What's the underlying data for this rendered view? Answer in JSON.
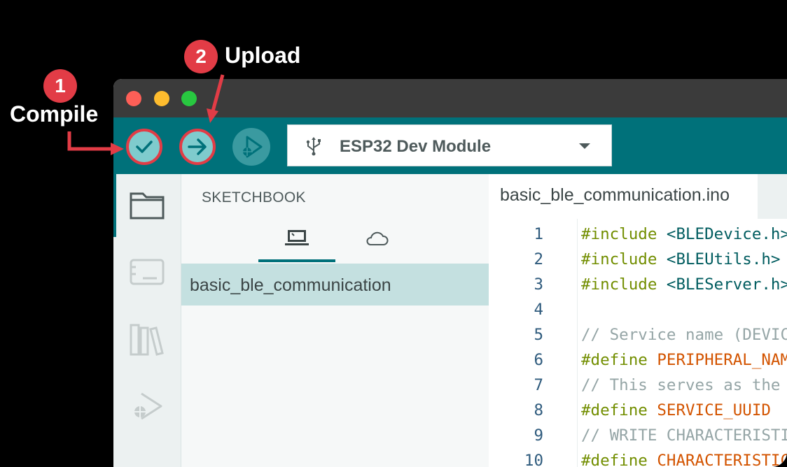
{
  "annotations": {
    "compile": {
      "number": "1",
      "label": "Compile"
    },
    "upload": {
      "number": "2",
      "label": "Upload"
    }
  },
  "window": {
    "traffic_lights": [
      "close",
      "minimize",
      "maximize"
    ]
  },
  "toolbar": {
    "verify_icon": "checkmark-icon",
    "upload_icon": "arrow-right-icon",
    "debug_icon": "debug-icon",
    "board_name": "ESP32 Dev Module",
    "board_icon": "usb-icon"
  },
  "sidebar": {
    "items": [
      "sketchbook-icon",
      "boards-manager-icon",
      "library-manager-icon",
      "debug-icon"
    ]
  },
  "sketchbook": {
    "title": "SKETCHBOOK",
    "tabs": [
      "local-icon",
      "cloud-icon"
    ],
    "items": [
      "basic_ble_communication"
    ]
  },
  "editor": {
    "tab_name": "basic_ble_communication.ino",
    "lines": [
      {
        "num": "1",
        "parts": [
          {
            "t": "#include ",
            "c": "kw"
          },
          {
            "t": "<BLEDevice.h>",
            "c": "inc"
          }
        ]
      },
      {
        "num": "2",
        "parts": [
          {
            "t": "#include ",
            "c": "kw"
          },
          {
            "t": "<BLEUtils.h>",
            "c": "inc"
          }
        ]
      },
      {
        "num": "3",
        "parts": [
          {
            "t": "#include ",
            "c": "kw"
          },
          {
            "t": "<BLEServer.h>",
            "c": "inc"
          }
        ]
      },
      {
        "num": "4",
        "parts": []
      },
      {
        "num": "5",
        "parts": [
          {
            "t": "// Service name (DEVICE",
            "c": "cm"
          }
        ]
      },
      {
        "num": "6",
        "parts": [
          {
            "t": "#define ",
            "c": "kw"
          },
          {
            "t": "PERIPHERAL_NAME",
            "c": "mac"
          }
        ]
      },
      {
        "num": "7",
        "parts": [
          {
            "t": "// This serves as the",
            "c": "cm"
          }
        ]
      },
      {
        "num": "8",
        "parts": [
          {
            "t": "#define ",
            "c": "kw"
          },
          {
            "t": "SERVICE_UUID",
            "c": "mac"
          }
        ]
      },
      {
        "num": "9",
        "parts": [
          {
            "t": "// WRITE CHARACTERISTIC",
            "c": "cm"
          }
        ]
      },
      {
        "num": "10",
        "parts": [
          {
            "t": "#define ",
            "c": "kw"
          },
          {
            "t": "CHARACTERISTIC",
            "c": "mac"
          }
        ]
      }
    ]
  },
  "colors": {
    "accent": "#00717a",
    "annotation_red": "#e23c46",
    "button_fill": "#7fcbcd"
  }
}
